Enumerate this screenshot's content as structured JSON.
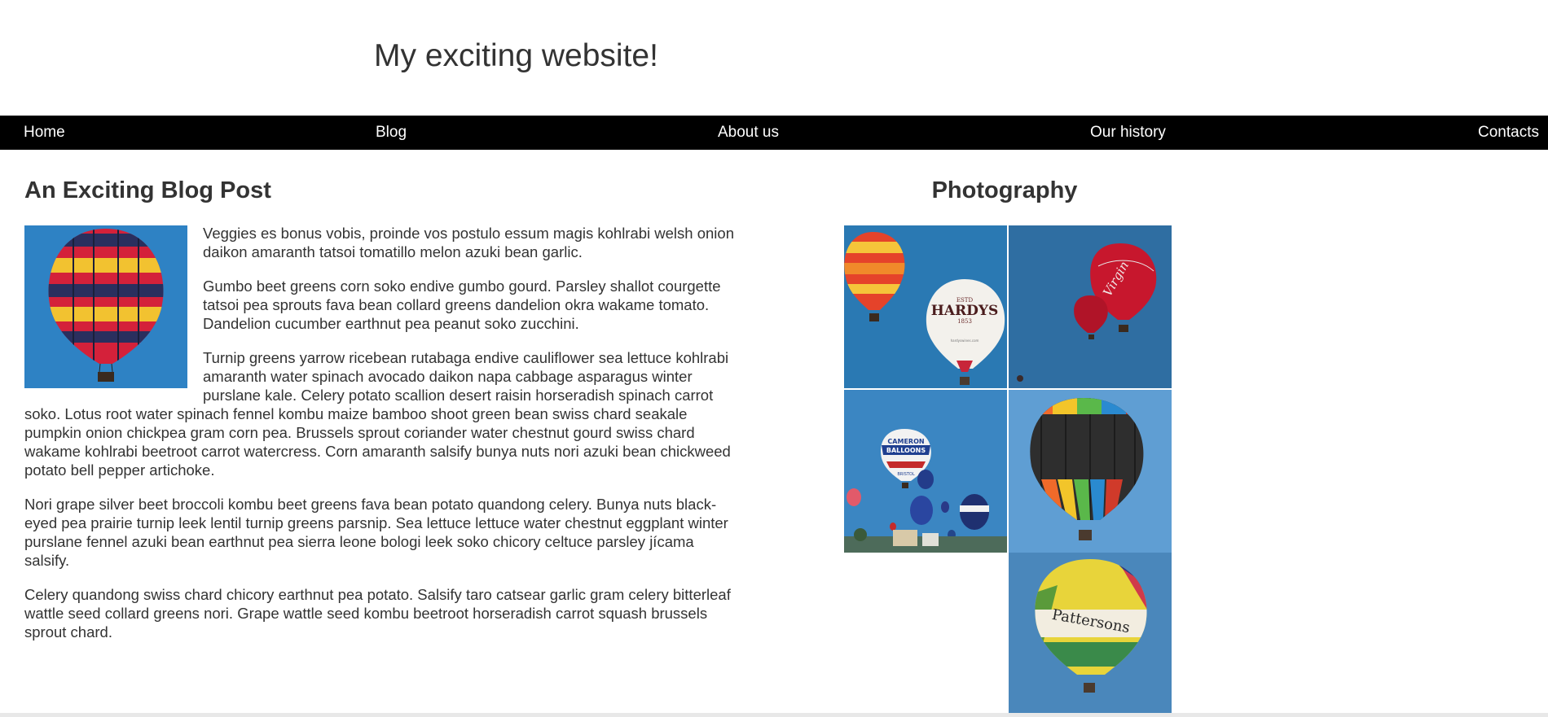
{
  "header": {
    "title": "My exciting website!"
  },
  "nav": {
    "items": [
      {
        "label": "Home"
      },
      {
        "label": "Blog"
      },
      {
        "label": "About us"
      },
      {
        "label": "Our history"
      },
      {
        "label": "Contacts"
      }
    ]
  },
  "post": {
    "title": "An Exciting Blog Post",
    "paragraphs": [
      "Veggies es bonus vobis, proinde vos postulo essum magis kohlrabi welsh onion daikon amaranth tatsoi tomatillo melon azuki bean garlic.",
      "Gumbo beet greens corn soko endive gumbo gourd. Parsley shallot courgette tatsoi pea sprouts fava bean collard greens dandelion okra wakame tomato. Dandelion cucumber earthnut pea peanut soko zucchini.",
      "Turnip greens yarrow ricebean rutabaga endive cauliflower sea lettuce kohlrabi amaranth water spinach avocado daikon napa cabbage asparagus winter purslane kale. Celery potato scallion desert raisin horseradish spinach carrot soko. Lotus root water spinach fennel kombu maize bamboo shoot green bean swiss chard seakale pumpkin onion chickpea gram corn pea. Brussels sprout coriander water chestnut gourd swiss chard wakame kohlrabi beetroot carrot watercress. Corn amaranth salsify bunya nuts nori azuki bean chickweed potato bell pepper artichoke.",
      "Nori grape silver beet broccoli kombu beet greens fava bean potato quandong celery. Bunya nuts black-eyed pea prairie turnip leek lentil turnip greens parsnip. Sea lettuce lettuce water chestnut eggplant winter purslane fennel azuki bean earthnut pea sierra leone bologi leek soko chicory celtuce parsley jícama salsify.",
      "Celery quandong swiss chard chicory earthnut pea potato. Salsify taro catsear garlic gram celery bitterleaf wattle seed collard greens nori. Grape wattle seed kombu beetroot horseradish carrot squash brussels sprout chard."
    ]
  },
  "sidebar": {
    "title": "Photography",
    "photos": [
      {
        "name": "balloons-hardys",
        "texts": [
          "ESTD",
          "HARDYS",
          "1853",
          "hardyswines.com"
        ]
      },
      {
        "name": "balloons-virgin",
        "texts": [
          "Virgin"
        ]
      },
      {
        "name": "balloons-festival",
        "texts": [
          "CAMERON",
          "BALLOONS",
          "BRISTOL"
        ]
      },
      {
        "name": "balloon-striped",
        "texts": []
      },
      {
        "name": "balloon-pattersons",
        "texts": [
          "Pattersons"
        ]
      }
    ]
  },
  "colors": {
    "nav_bg": "#000000",
    "nav_text": "#ffffff",
    "text": "#333333",
    "sky": "#2f7db6"
  }
}
